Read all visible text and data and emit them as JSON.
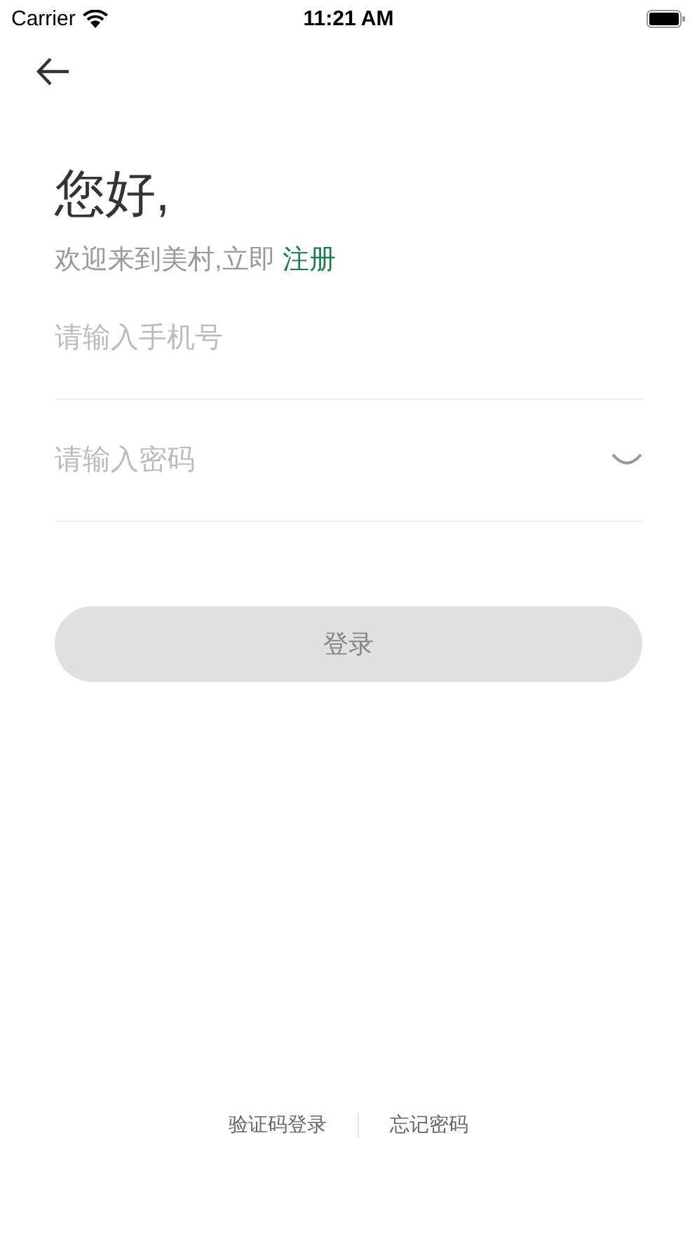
{
  "status_bar": {
    "carrier": "Carrier",
    "time": "11:21 AM"
  },
  "greeting": "您好,",
  "subtitle": {
    "text": "欢迎来到美村,立即",
    "link": "注册"
  },
  "fields": [
    {
      "placeholder": "请输入手机号"
    },
    {
      "placeholder": "请输入密码",
      "password_visible": false
    }
  ],
  "login_button": {
    "label": "登录",
    "disabled": true
  },
  "footer_links": [
    "验证码登录",
    "忘记密码"
  ]
}
